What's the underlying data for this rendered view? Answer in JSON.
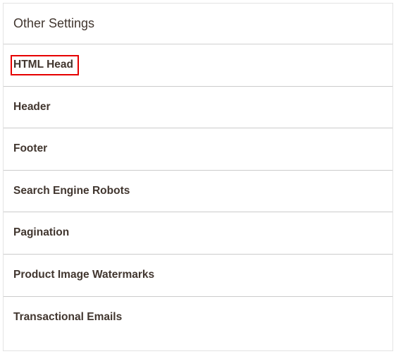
{
  "panel": {
    "title": "Other Settings"
  },
  "sections": [
    {
      "label": "HTML Head",
      "highlighted": true
    },
    {
      "label": "Header",
      "highlighted": false
    },
    {
      "label": "Footer",
      "highlighted": false
    },
    {
      "label": "Search Engine Robots",
      "highlighted": false
    },
    {
      "label": "Pagination",
      "highlighted": false
    },
    {
      "label": "Product Image Watermarks",
      "highlighted": false
    },
    {
      "label": "Transactional Emails",
      "highlighted": false
    }
  ],
  "colors": {
    "highlight_border": "#e60000",
    "panel_border": "#e3e3e3",
    "divider": "#cccccc",
    "text": "#41362f"
  }
}
